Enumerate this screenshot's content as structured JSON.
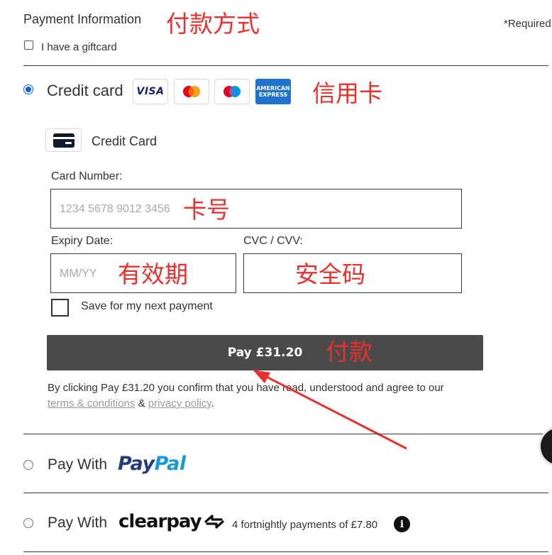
{
  "header": {
    "title": "Payment Information",
    "required": "*Required",
    "giftcard_label": "I have a giftcard",
    "annotation": "付款方式"
  },
  "credit_card": {
    "label": "Credit card",
    "annotation": "信用卡",
    "brands": [
      {
        "name": "Visa",
        "text": "VISA"
      },
      {
        "name": "Mastercard"
      },
      {
        "name": "Maestro"
      },
      {
        "name": "American Express",
        "line1": "AMERICAN",
        "line2": "EXPRESS"
      }
    ],
    "method_title": "Credit Card",
    "card_number_label": "Card Number:",
    "card_number_placeholder": "1234 5678 9012 3456",
    "card_number_annotation": "卡号",
    "expiry_label": "Expiry Date:",
    "expiry_placeholder": "MM/YY",
    "expiry_annotation": "有效期",
    "cvc_label": "CVC / CVV:",
    "cvc_annotation": "安全码",
    "save_label": "Save for my next payment",
    "pay_button": "Pay £31.20",
    "pay_annotation": "付款",
    "terms_prefix": "By clicking Pay £31.20 you confirm that you have read, understood and agree to our",
    "terms_link": "terms & conditions",
    "amp": "&",
    "privacy_link": "privacy policy",
    "period": "."
  },
  "paypal": {
    "label": "Pay With",
    "logo_pay": "Pay",
    "logo_pal": "Pal"
  },
  "clearpay": {
    "label": "Pay With",
    "logo": "clearpay",
    "installments": "4 fortnightly payments of £7.80",
    "info_icon_text": "i"
  },
  "colors": {
    "accent_radio": "#0a64d8",
    "pay_button_bg": "#4a4a4a",
    "annotation_red": "#e8312f",
    "paypal_dark": "#253b80",
    "paypal_light": "#179bd7"
  }
}
